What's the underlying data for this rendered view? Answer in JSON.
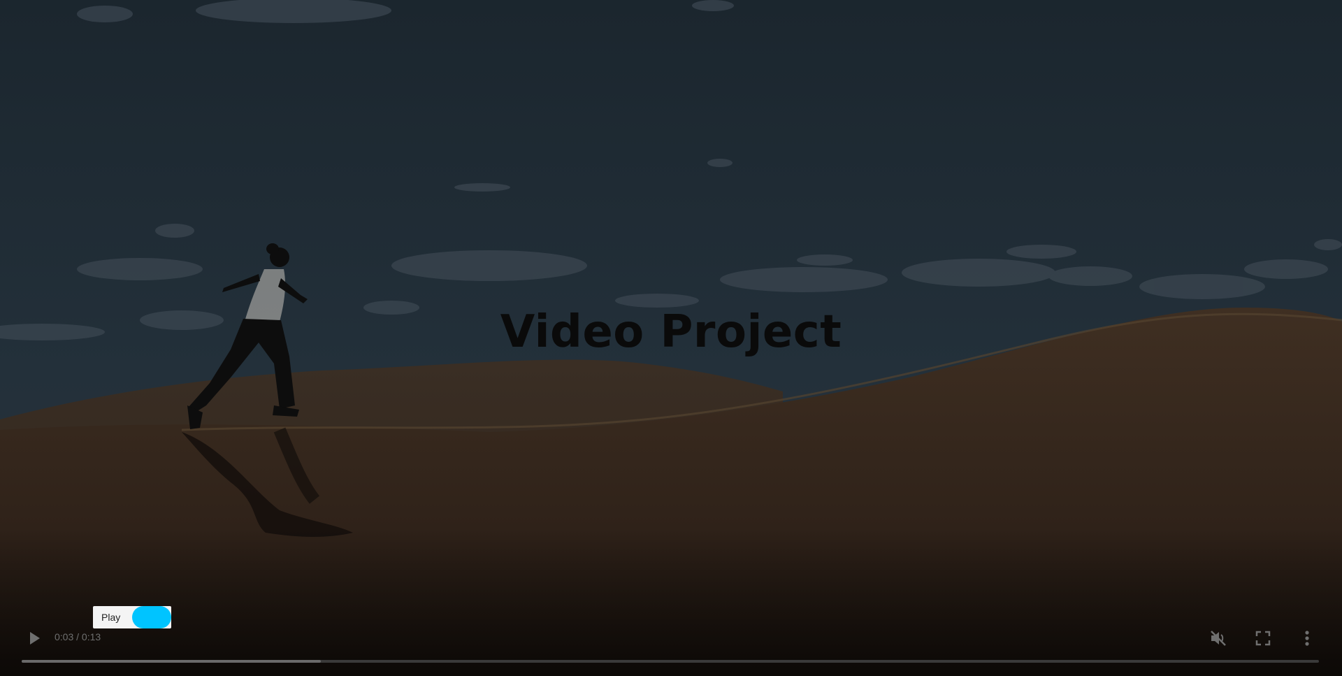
{
  "video": {
    "title": "Video Project",
    "progress_fraction": 0.2308,
    "time_display": "0:03 / 0:13"
  },
  "overlay_control": {
    "label": "Play",
    "toggle_color": "#00c4ff"
  },
  "controls": {
    "play_icon": "play-icon",
    "mute_icon": "volume-muted-icon",
    "fullscreen_icon": "fullscreen-icon",
    "more_icon": "more-vert-icon"
  },
  "colors": {
    "sky": "#1d2a33",
    "sand": "#3a2a1d",
    "accent": "#00c4ff",
    "icon": "#6f6f6f"
  }
}
